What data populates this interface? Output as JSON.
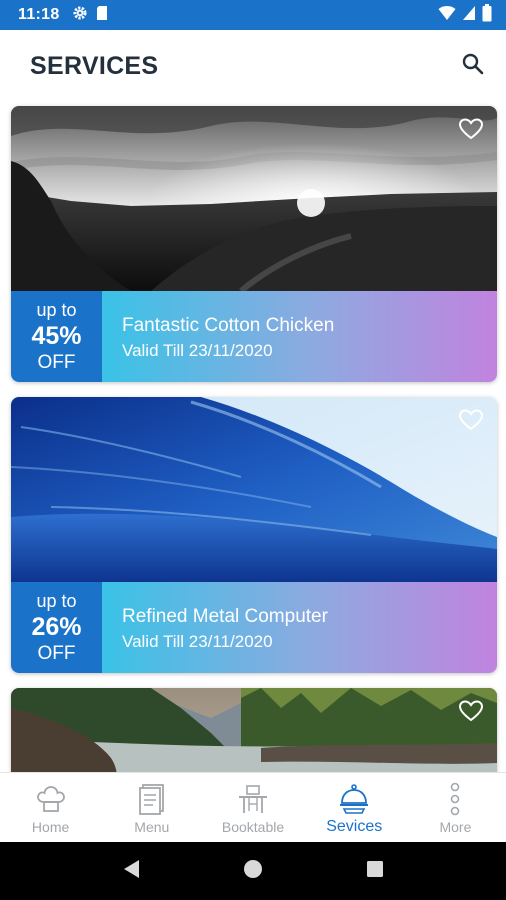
{
  "status_bar": {
    "time": "11:18",
    "left_icons": [
      "gear-icon",
      "sim-card-icon"
    ],
    "right_icons": [
      "wifi-icon",
      "signal-icon",
      "battery-icon"
    ],
    "background": "#1a73c9"
  },
  "header": {
    "title": "SERVICES",
    "search_icon": "search-icon"
  },
  "offers": [
    {
      "discount_prefix": "up to",
      "discount_value": "45%",
      "discount_suffix": "OFF",
      "title": "Fantastic Cotton Chicken",
      "valid_till": "Valid Till 23/11/2020",
      "image": "black-and-white landscape at sunset",
      "favorite_icon": "heart-outline-icon"
    },
    {
      "discount_prefix": "up to",
      "discount_value": "26%",
      "discount_suffix": "OFF",
      "title": "Refined Metal Computer",
      "valid_till": "Valid Till 23/11/2020",
      "image": "blue ocean wave",
      "favorite_icon": "heart-outline-icon"
    },
    {
      "image": "mountain river with forest",
      "favorite_icon": "heart-outline-icon"
    }
  ],
  "bottom_nav": {
    "items": [
      {
        "label": "Home",
        "icon": "chef-hat-icon",
        "active": false
      },
      {
        "label": "Menu",
        "icon": "menu-book-icon",
        "active": false
      },
      {
        "label": "Booktable",
        "icon": "table-icon",
        "active": false
      },
      {
        "label": "Sevices",
        "icon": "cloche-icon",
        "active": true
      },
      {
        "label": "More",
        "icon": "more-dots-icon",
        "active": false
      }
    ],
    "active_color": "#1a73c9",
    "inactive_color": "#a3a7ab"
  },
  "system_nav": {
    "buttons": [
      "back-icon",
      "home-circle-icon",
      "recents-square-icon"
    ]
  },
  "colors": {
    "accent": "#1a73c9",
    "title": "#24313d",
    "gradient_start": "#3ac2e6",
    "gradient_end": "#c183df"
  }
}
